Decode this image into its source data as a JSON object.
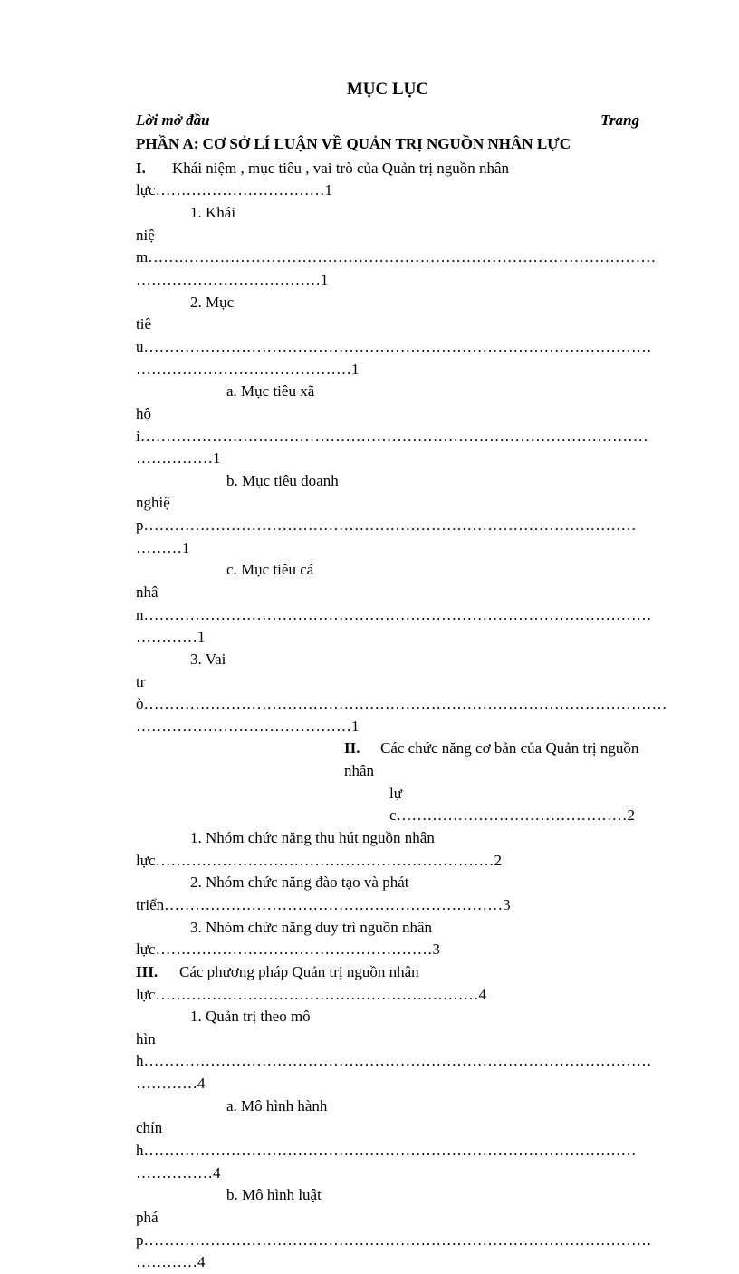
{
  "title": "MỤC LỤC",
  "header_left": "Lời mở đầu",
  "header_right": "Trang",
  "part_a": "PHẦN A: CƠ SỞ LÍ LUẬN VỀ QUẢN TRỊ NGUỒN NHÂN LỰC",
  "i_label": "I.",
  "i_inline": "Khái niệm , mục tiêu , vai trò của Quản trị nguồn nhân",
  "i_cont": "lực……………………………1",
  "k1_head": "1. Khái",
  "k1_line1": "niệm………………………………………………………………………………………",
  "k1_line2": "………………………………1",
  "k2_head": "2. Mục",
  "k2_line1": "tiêu………………………………………………………………………………………",
  "k2_line2": "……………………………………1",
  "a_head": "a. Mục tiêu xã",
  "a_line1": "hội………………………………………………………………………………………",
  "a_line2": "……………1",
  "b_head": "b. Mục tiêu doanh",
  "b_line1": "nghiệp……………………………………………………………………………………",
  "b_line2": "………1",
  "c_head": "c. Mục tiêu cá",
  "c_line1": "nhân………………………………………………………………………………………",
  "c_line2": "…………1",
  "v_head": "3. Vai",
  "v_line1": "trò…………………………………………………………………………………………",
  "v_line2": "……………………………………1",
  "ii_label": "II.",
  "ii_inline": "Các chức năng cơ bản của Quản trị nguồn nhân",
  "ii_cont": "lực………………………………………2",
  "n1_head": "1. Nhóm chức năng thu hút nguồn nhân",
  "n1_line": "lực…………………………………………………………2",
  "n2_head": "2. Nhóm chức năng đào tạo và phát",
  "n2_line": "triển…………………………………………………………3",
  "n3_head": "3. Nhóm chức năng duy trì nguồn nhân",
  "n3_line": "lực………………………………………………3",
  "iii_label": "III.",
  "iii_inline": "Các phương pháp Quản trị nguồn nhân",
  "iii_cont": "lực………………………………………………………4",
  "q_head": "1. Quản trị theo mô",
  "q_line1": "hình………………………………………………………………………………………",
  "q_line2": "…………4",
  "am_head": "a. Mô hình hành",
  "am_line1": "chính……………………………………………………………………………………",
  "am_line2": "……………4",
  "bm_head": "b. Mô hình luật",
  "bm_line1": "pháp………………………………………………………………………………………",
  "bm_line2": "…………4"
}
